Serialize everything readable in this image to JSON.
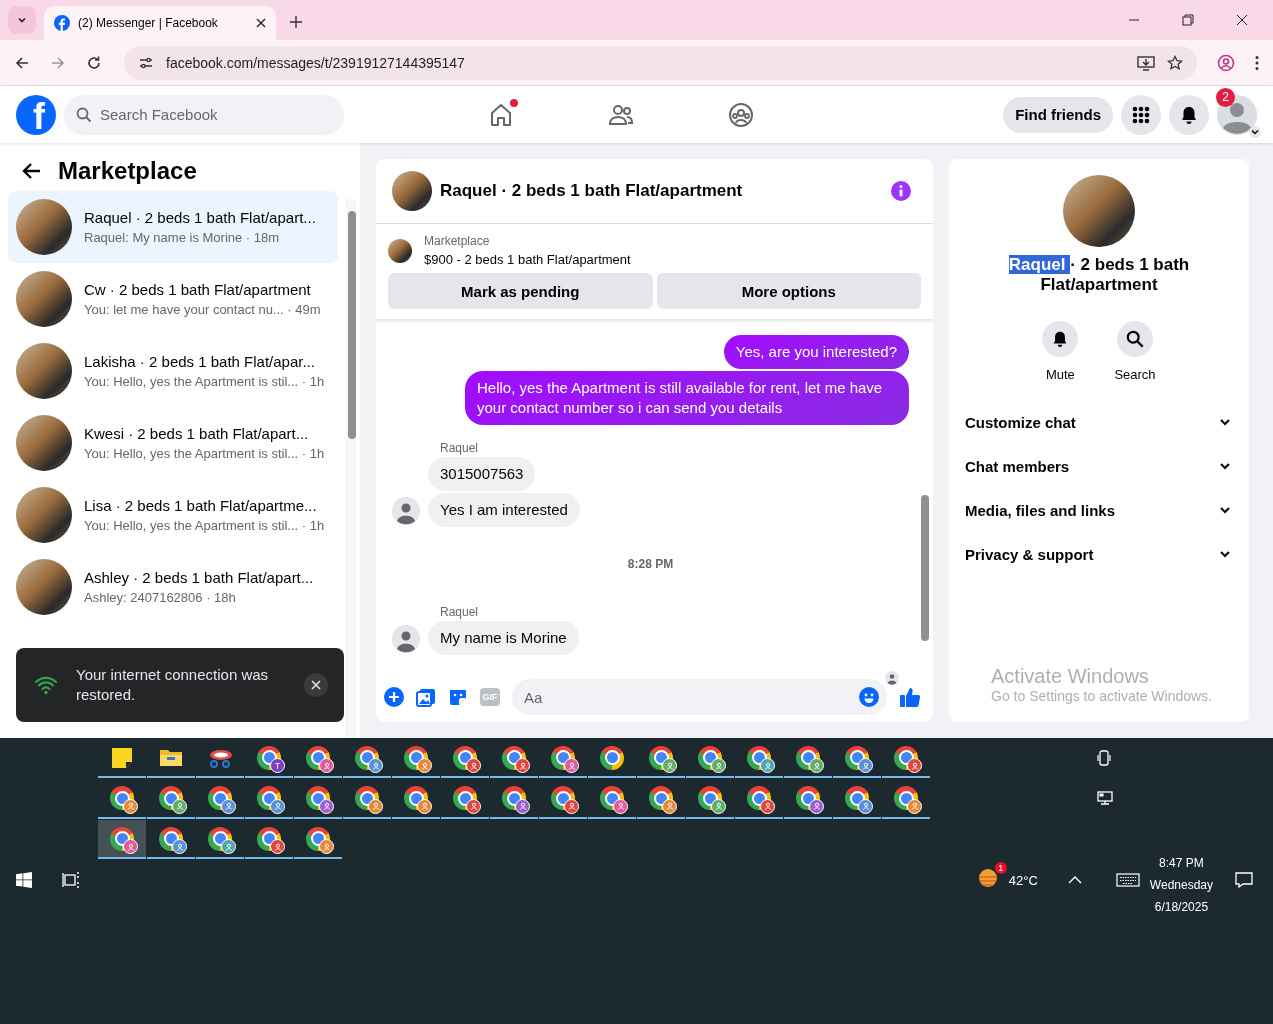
{
  "browser": {
    "tab": {
      "title": "(2) Messenger | Facebook",
      "selected": true
    },
    "url": "facebook.com/messages/t/23919127144395147"
  },
  "header": {
    "logo": "f",
    "search": {
      "placeholder": "Search Facebook"
    },
    "nav": [
      {
        "kind": "home",
        "selected": false,
        "dot": true
      },
      {
        "kind": "friends",
        "selected": false,
        "dot": false
      },
      {
        "kind": "groups",
        "selected": false,
        "dot": false
      }
    ],
    "find_friends": "Find friends",
    "notification_count": "2"
  },
  "sidebar": {
    "title": "Marketplace",
    "conversations": [
      {
        "title": "Raquel · 2 beds 1 bath Flat/apart...",
        "snippet": "Raquel: My name is Morine · 18m",
        "selected": true
      },
      {
        "title": "Cw · 2 beds 1 bath Flat/apartment",
        "snippet": "You: let me have your contact nu...  · 49m",
        "selected": false
      },
      {
        "title": "Lakisha · 2 beds 1 bath Flat/apar...",
        "snippet": "You: Hello, yes the Apartment is stil... · 1h",
        "selected": false
      },
      {
        "title": "Kwesi · 2 beds 1 bath Flat/apart...",
        "snippet": "You: Hello, yes the Apartment is stil... · 1h",
        "selected": false
      },
      {
        "title": "Lisa · 2 beds 1 bath Flat/apartme...",
        "snippet": "You: Hello, yes the Apartment is stil... · 1h",
        "selected": false
      },
      {
        "title": "Ashley · 2 beds 1 bath Flat/apart...",
        "snippet": "Ashley: 2407162806 · 18h",
        "selected": false
      }
    ]
  },
  "toast": {
    "text": "Your internet connection was restored."
  },
  "chat": {
    "title": "Raquel · 2 beds 1 bath Flat/apartment",
    "listing": {
      "label": "Marketplace",
      "text": "$900 - 2 beds 1 bath Flat/apartment"
    },
    "buttons": [
      "Mark as pending",
      "More options"
    ],
    "messages": [
      {
        "kind": "sent",
        "text": "Yes, are you interested?"
      },
      {
        "kind": "sent",
        "text": "Hello, yes the Apartment is still available for rent, let me have your contact number so i can send you details"
      },
      {
        "kind": "sender",
        "text": "Raquel"
      },
      {
        "kind": "received",
        "text": "3015007563",
        "avatar": false
      },
      {
        "kind": "received",
        "text": "Yes I am interested",
        "avatar": true
      },
      {
        "kind": "time",
        "text": "8:28 PM"
      },
      {
        "kind": "sender",
        "text": "Raquel"
      },
      {
        "kind": "received",
        "text": "My name is Morine",
        "avatar": true
      }
    ],
    "composer": {
      "gif": "GIF",
      "placeholder": "Aa"
    }
  },
  "details": {
    "title_parts": [
      {
        "text": "Raquel ",
        "selected": true
      },
      {
        "text": "· 2 beds 1 bath Flat/apartment",
        "selected": false
      }
    ],
    "actions": [
      {
        "kind": "mute",
        "label": "Mute"
      },
      {
        "kind": "search",
        "label": "Search"
      }
    ],
    "sections": [
      {
        "label": "Customize chat",
        "expanded": false
      },
      {
        "label": "Chat members",
        "expanded": false
      },
      {
        "label": "Media, files and links",
        "expanded": false
      },
      {
        "label": "Privacy & support",
        "expanded": false
      }
    ]
  },
  "activation": {
    "title": "Activate Windows",
    "text": "Go to Settings to activate Windows."
  },
  "taskbar": {
    "app_rows": [
      [
        {
          "kind": "sticky-notes",
          "selected": false
        },
        {
          "kind": "file-explorer",
          "selected": false
        },
        {
          "kind": "snipping",
          "selected": false
        },
        {
          "kind": "chrome",
          "color": "#7b3fc4",
          "badge": "T",
          "selected": false
        },
        {
          "kind": "chrome",
          "color": "#e05a9c",
          "selected": false
        },
        {
          "kind": "chrome",
          "color": "#5b8fd6",
          "selected": false
        },
        {
          "kind": "chrome",
          "color": "#e8883a",
          "selected": false
        },
        {
          "kind": "chrome",
          "color": "#e0463b",
          "selected": false
        },
        {
          "kind": "chrome",
          "color": "#e0463b",
          "selected": false
        },
        {
          "kind": "chrome",
          "color": "#e05a9c",
          "selected": false
        },
        {
          "kind": "chrome-plain",
          "selected": false
        },
        {
          "kind": "chrome",
          "color": "#5fae6a",
          "selected": false
        },
        {
          "kind": "chrome",
          "color": "#5fae6a",
          "selected": false
        },
        {
          "kind": "chrome",
          "color": "#4fa8a8",
          "selected": false
        },
        {
          "kind": "chrome",
          "color": "#5fae6a",
          "selected": false
        },
        {
          "kind": "chrome",
          "color": "#5b8fd6",
          "selected": false
        },
        {
          "kind": "chrome",
          "color": "#e0463b",
          "selected": false
        }
      ],
      [
        {
          "kind": "chrome",
          "color": "#e8883a",
          "selected": false
        },
        {
          "kind": "chrome",
          "color": "#5fae6a",
          "selected": false
        },
        {
          "kind": "chrome",
          "color": "#5b8fd6",
          "selected": false
        },
        {
          "kind": "chrome",
          "color": "#5b8fd6",
          "selected": false
        },
        {
          "kind": "chrome",
          "color": "#9b5fd0",
          "selected": false
        },
        {
          "kind": "chrome",
          "color": "#e8883a",
          "selected": false
        },
        {
          "kind": "chrome",
          "color": "#e8883a",
          "selected": false
        },
        {
          "kind": "chrome",
          "color": "#e0463b",
          "selected": false
        },
        {
          "kind": "chrome",
          "color": "#9b5fd0",
          "selected": false
        },
        {
          "kind": "chrome",
          "color": "#e0463b",
          "selected": false
        },
        {
          "kind": "chrome",
          "color": "#e05a9c",
          "selected": false
        },
        {
          "kind": "chrome",
          "color": "#e8883a",
          "selected": false
        },
        {
          "kind": "chrome",
          "color": "#5fae6a",
          "selected": false
        },
        {
          "kind": "chrome",
          "color": "#e0463b",
          "selected": false
        },
        {
          "kind": "chrome",
          "color": "#9b5fd0",
          "selected": false
        },
        {
          "kind": "chrome",
          "color": "#5b8fd6",
          "selected": false
        },
        {
          "kind": "chrome",
          "color": "#e8883a",
          "selected": false
        }
      ],
      [
        {
          "kind": "chrome",
          "color": "#e05a9c",
          "selected": true
        },
        {
          "kind": "chrome",
          "color": "#5b8fd6",
          "selected": false
        },
        {
          "kind": "chrome",
          "color": "#4fa8a8",
          "selected": false
        },
        {
          "kind": "chrome",
          "color": "#e0463b",
          "selected": false
        },
        {
          "kind": "chrome",
          "color": "#e8883a",
          "selected": false
        }
      ]
    ],
    "weather_badge": "1",
    "temperature": "42°C",
    "time": "8:47 PM",
    "day": "Wednesday",
    "date": "6/18/2025"
  }
}
